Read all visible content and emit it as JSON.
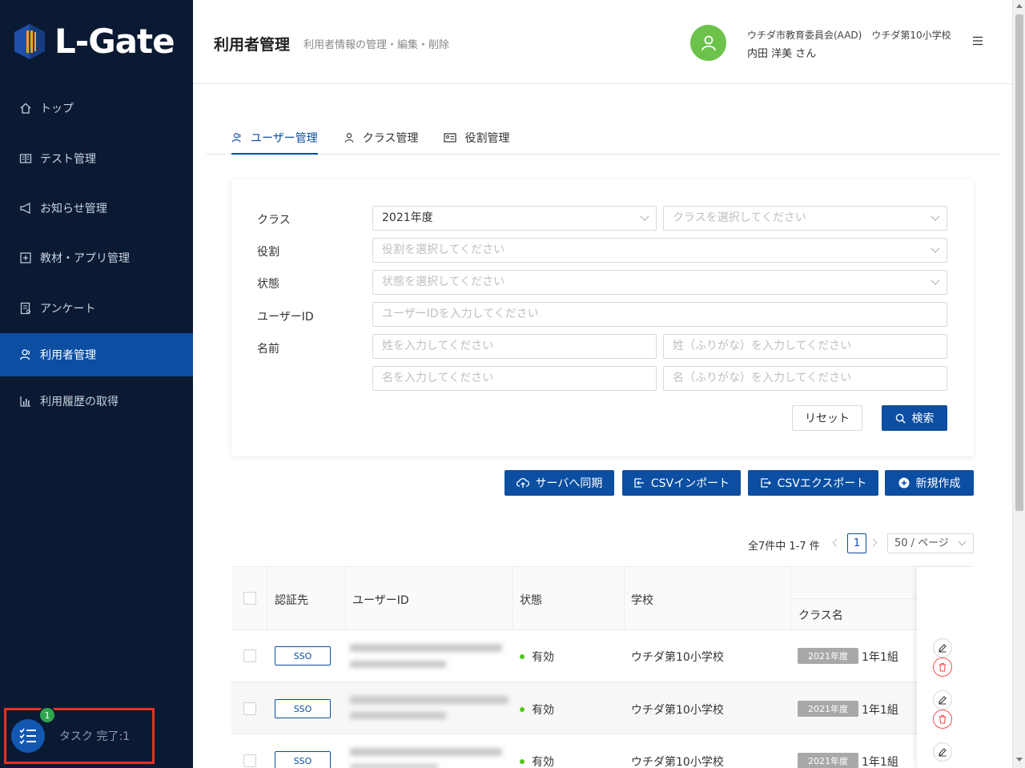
{
  "brand": {
    "name": "L-Gate",
    "accent": "#0b4ea2",
    "sidebar_bg": "#0b1a33"
  },
  "sidebar": {
    "items": [
      {
        "label": "トップ",
        "icon": "home-icon"
      },
      {
        "label": "テスト管理",
        "icon": "book-icon"
      },
      {
        "label": "お知らせ管理",
        "icon": "megaphone-icon"
      },
      {
        "label": "教材・アプリ管理",
        "icon": "plus-square-icon"
      },
      {
        "label": "アンケート",
        "icon": "survey-icon"
      },
      {
        "label": "利用者管理",
        "icon": "users-icon",
        "active": true
      },
      {
        "label": "利用履歴の取得",
        "icon": "bar-chart-icon"
      }
    ],
    "task": {
      "badge": "1",
      "label": "タスク 完了:1"
    }
  },
  "header": {
    "title": "利用者管理",
    "subtitle": "利用者情報の管理・編集・削除",
    "user_org": "ウチダ市教育委員会(AAD)　ウチダ第10小学校",
    "user_name": "内田 洋美 さん"
  },
  "tabs": [
    {
      "label": "ユーザー管理",
      "active": true
    },
    {
      "label": "クラス管理"
    },
    {
      "label": "役割管理"
    }
  ],
  "filters": {
    "class_label": "クラス",
    "class_year_value": "2021年度",
    "class_placeholder": "クラスを選択してください",
    "role_label": "役割",
    "role_placeholder": "役割を選択してください",
    "status_label": "状態",
    "status_placeholder": "状態を選択してください",
    "userid_label": "ユーザーID",
    "userid_placeholder": "ユーザーIDを入力してください",
    "name_label": "名前",
    "last_name_placeholder": "姓を入力してください",
    "last_kana_placeholder": "姓（ふりがな）を入力してください",
    "first_name_placeholder": "名を入力してください",
    "first_kana_placeholder": "名（ふりがな）を入力してください",
    "reset_label": "リセット",
    "search_label": "検索"
  },
  "actions": {
    "sync_label": "サーバへ同期",
    "csv_import_label": "CSVインポート",
    "csv_export_label": "CSVエクスポート",
    "new_label": "新規作成"
  },
  "pagination": {
    "total_text": "全7件中 1-7 件",
    "current_page": "1",
    "page_size": "50 / ページ"
  },
  "table": {
    "headers": {
      "auth": "認証先",
      "userid": "ユーザーID",
      "status": "状態",
      "school": "学校",
      "class_name": "クラス名"
    },
    "rows": [
      {
        "auth": "SSO",
        "status": "有効",
        "school": "ウチダ第10小学校",
        "year": "2021年度",
        "class": "1年1組"
      },
      {
        "auth": "SSO",
        "status": "有効",
        "school": "ウチダ第10小学校",
        "year": "2021年度",
        "class": "1年1組"
      },
      {
        "auth": "SSO",
        "status": "有効",
        "school": "ウチダ第10小学校",
        "year": "2021年度",
        "class": "1年1組"
      }
    ]
  }
}
